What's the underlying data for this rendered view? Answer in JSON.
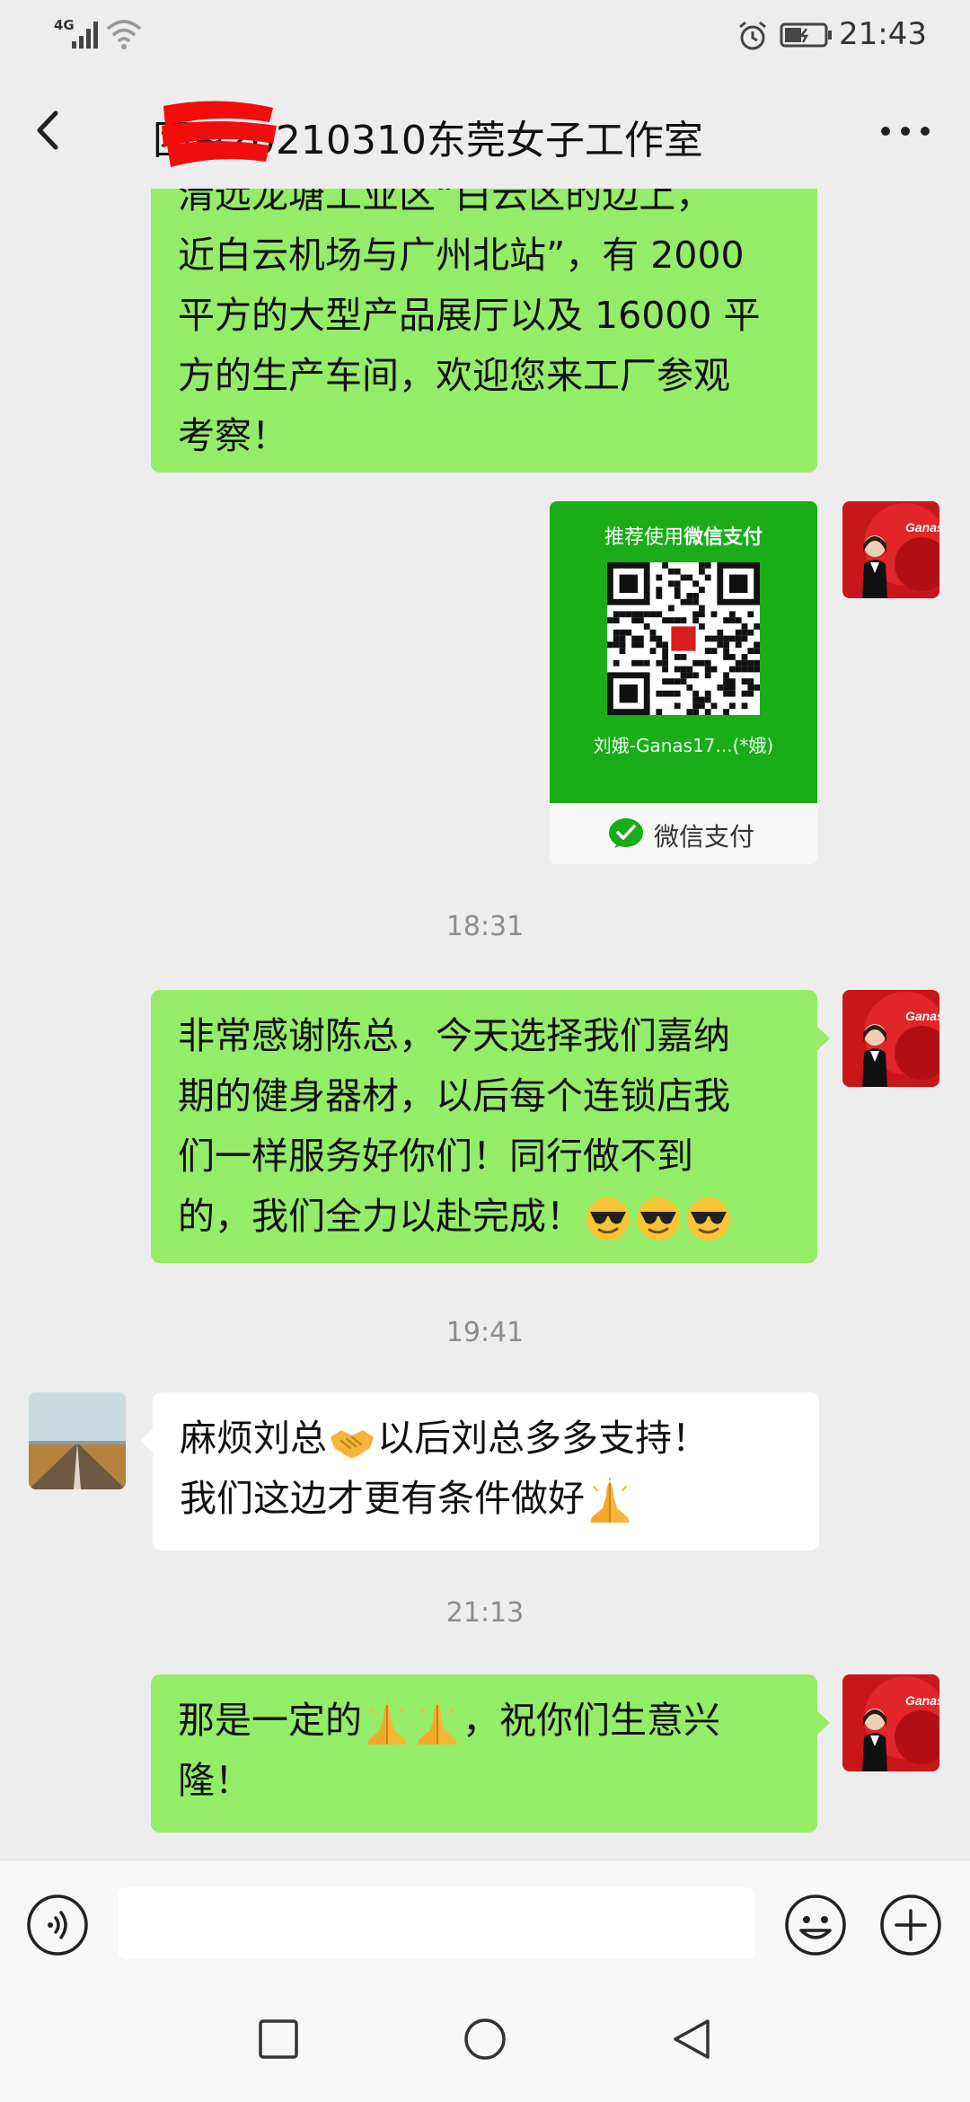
{
  "status_bar": {
    "network": "4G",
    "time": "21:43"
  },
  "header": {
    "title": "团~20210310东莞女子工作室"
  },
  "messages": [
    {
      "sender": "me",
      "lines": [
        "清远龙塘工业区“白云区的边上，",
        "近白云机场与广州北站”，有 2000",
        "平方的大型产品展厅以及 16000 平",
        "方的生产车间，欢迎您来工厂参观",
        "考察！"
      ]
    },
    {
      "sender": "me",
      "type": "pay_card",
      "title_prefix": "推荐使用",
      "title_bold": "微信支付",
      "payee": "刘娥-Ganas17...(*娥)",
      "footer_label": "微信支付"
    },
    {
      "type": "timestamp",
      "text": "18:31"
    },
    {
      "sender": "me",
      "lines": [
        "非常感谢陈总，今天选择我们嘉纳",
        "期的健身器材，以后每个连锁店我",
        "们一样服务好你们！同行做不到",
        "的，我们全力以赴完成！"
      ],
      "emoji": [
        "sunglasses",
        "sunglasses",
        "sunglasses"
      ]
    },
    {
      "type": "timestamp",
      "text": "19:41"
    },
    {
      "sender": "other",
      "line1_a": "麻烦刘总",
      "line1_b": "以后刘总多多支持！",
      "line2": "我们这边才更有条件做好",
      "emoji": [
        "handshake",
        "folded-hands"
      ]
    },
    {
      "type": "timestamp",
      "text": "21:13"
    },
    {
      "sender": "me",
      "line1_a": "那是一定的",
      "line1_b": "，祝你们生意兴",
      "line2": "隆！",
      "emoji": [
        "folded-hands",
        "folded-hands"
      ]
    }
  ],
  "input_bar": {
    "placeholder": ""
  },
  "avatar_me": {
    "brand_text": "Ganas"
  },
  "colors": {
    "background": "#ededed",
    "my_bubble": "#95ec69",
    "other_bubble": "#ffffff",
    "pay_green": "#1aad19",
    "brand_red": "#d81e1e"
  },
  "icons": [
    "signal-icon",
    "wifi-icon",
    "alarm-icon",
    "battery-icon",
    "back-icon",
    "more-icon",
    "voice-icon",
    "emoji-icon",
    "plus-icon",
    "recent-apps-icon",
    "home-icon",
    "nav-back-icon",
    "wechat-pay-icon",
    "qr-code-icon"
  ]
}
